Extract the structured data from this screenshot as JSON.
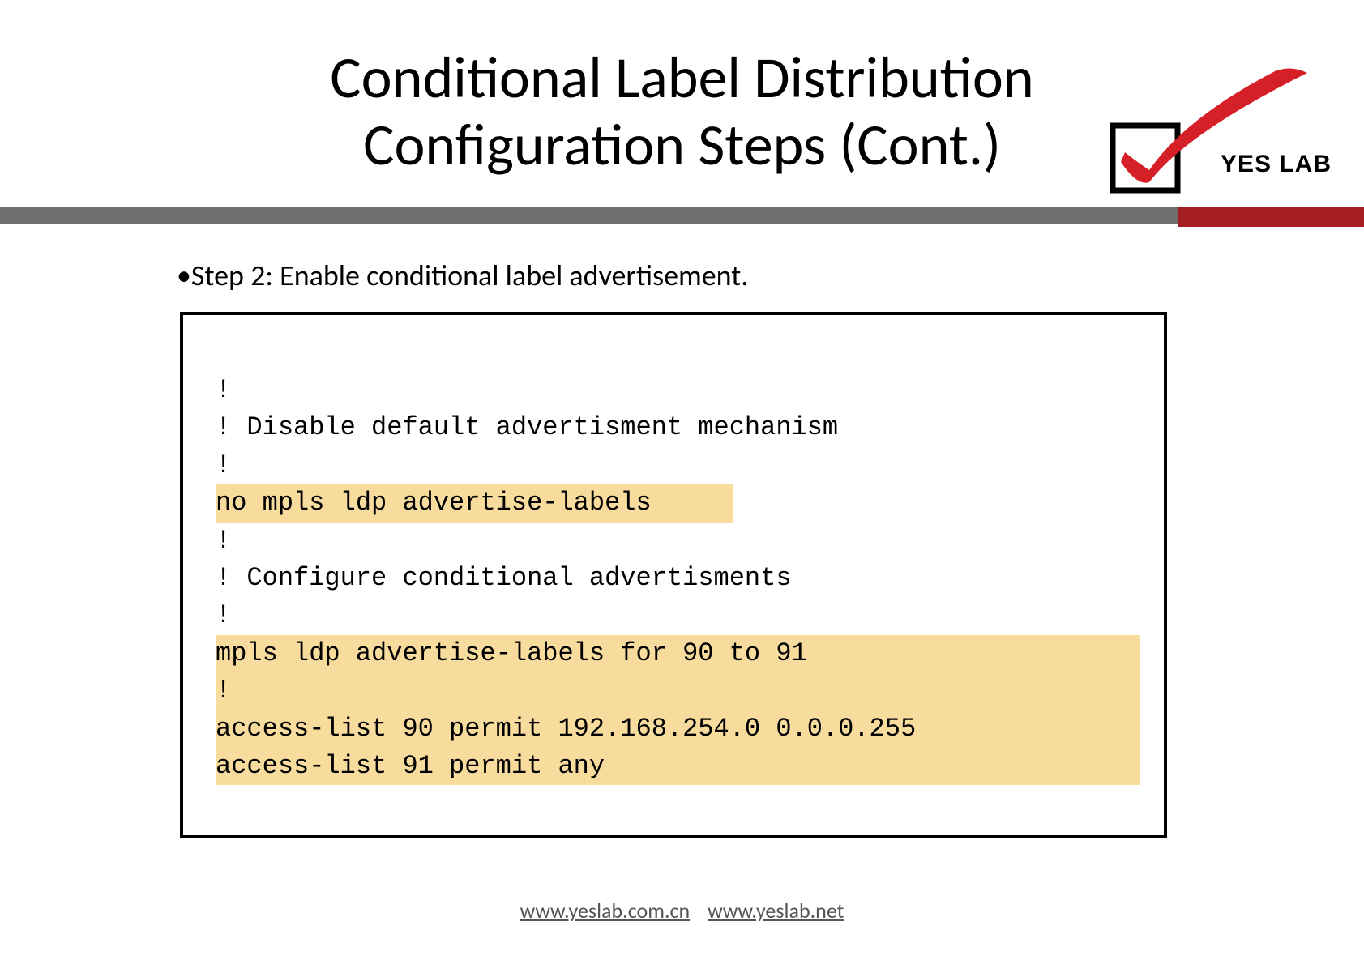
{
  "title_line1": "Conditional Label Distribution",
  "title_line2": "Configuration Steps (Cont.)",
  "logo_label": "YES LAB",
  "step2": "•Step 2: Enable conditional label advertisement.",
  "code": {
    "l1": "!",
    "l2": "! Disable default advertisment mechanism",
    "l3": "!",
    "l4": "no mpls ldp advertise-labels",
    "l5": "!",
    "l6": "! Configure conditional advertisments",
    "l7": "!",
    "l8": "mpls ldp advertise-labels for 90 to 91",
    "l9": "!",
    "l10": "access-list 90 permit 192.168.254.0 0.0.0.255",
    "l11": "access-list 91 permit any"
  },
  "footer": {
    "link1": "www.yeslab.com.cn",
    "link2": "www.yeslab.net"
  }
}
